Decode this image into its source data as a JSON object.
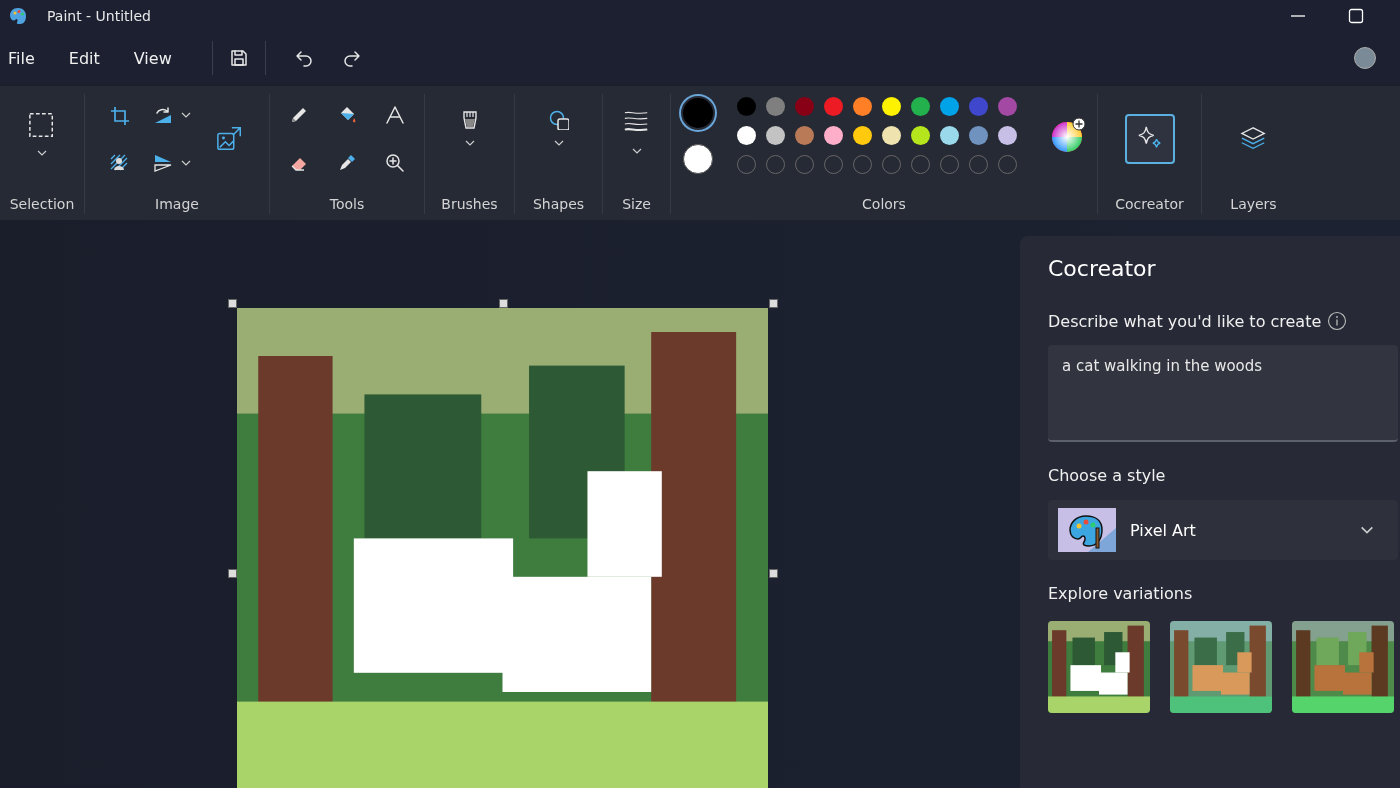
{
  "window": {
    "title": "Paint - Untitled"
  },
  "menu": [
    {
      "label": "File"
    },
    {
      "label": "Edit"
    },
    {
      "label": "View"
    }
  ],
  "quick_actions": [
    {
      "kind": "save"
    },
    {
      "kind": "undo"
    },
    {
      "kind": "redo"
    }
  ],
  "ribbon": [
    {
      "label": "Selection",
      "tools": [
        {
          "kind": "select",
          "dropdown": true
        }
      ]
    },
    {
      "label": "Image",
      "tools": [
        {
          "kind": "crop",
          "dropdown": false
        },
        {
          "kind": "rotate",
          "dropdown": true
        },
        {
          "kind": "resize",
          "dropdown": false
        },
        {
          "kind": "hatch",
          "dropdown": false
        },
        {
          "kind": "flip",
          "dropdown": true
        }
      ]
    },
    {
      "label": "Tools",
      "tools": [
        {
          "kind": "pencil",
          "dropdown": false
        },
        {
          "kind": "fill",
          "dropdown": false
        },
        {
          "kind": "text",
          "dropdown": false
        },
        {
          "kind": "eraser",
          "dropdown": false
        },
        {
          "kind": "picker",
          "dropdown": false
        },
        {
          "kind": "zoom",
          "dropdown": false
        }
      ]
    },
    {
      "label": "Brushes",
      "tools": [
        {
          "kind": "brush",
          "dropdown": true
        }
      ]
    },
    {
      "label": "Shapes",
      "tools": [
        {
          "kind": "shapes",
          "dropdown": true
        }
      ]
    },
    {
      "label": "Size",
      "tools": [
        {
          "kind": "size",
          "dropdown": true
        }
      ]
    }
  ],
  "colors": {
    "label": "Colors",
    "current": [
      {
        "color": "#000000",
        "selected": true
      },
      {
        "color": "#ffffff",
        "selected": false
      }
    ],
    "palette": [
      {
        "kind": "swatch",
        "color": "#000000"
      },
      {
        "kind": "swatch",
        "color": "#7f7f7f"
      },
      {
        "kind": "swatch",
        "color": "#880015"
      },
      {
        "kind": "swatch",
        "color": "#ed1c24"
      },
      {
        "kind": "swatch",
        "color": "#ff7f27"
      },
      {
        "kind": "swatch",
        "color": "#fff200"
      },
      {
        "kind": "swatch",
        "color": "#22b14c"
      },
      {
        "kind": "swatch",
        "color": "#00a2e8"
      },
      {
        "kind": "swatch",
        "color": "#3f48cc"
      },
      {
        "kind": "swatch",
        "color": "#a349a4"
      },
      {
        "kind": "swatch",
        "color": "#ffffff"
      },
      {
        "kind": "swatch",
        "color": "#c3c3c3"
      },
      {
        "kind": "swatch",
        "color": "#b97a57"
      },
      {
        "kind": "swatch",
        "color": "#ffaec9"
      },
      {
        "kind": "swatch",
        "color": "#ffc90e"
      },
      {
        "kind": "swatch",
        "color": "#efe4b0"
      },
      {
        "kind": "swatch",
        "color": "#b5e61d"
      },
      {
        "kind": "swatch",
        "color": "#99d9ea"
      },
      {
        "kind": "swatch",
        "color": "#7092be"
      },
      {
        "kind": "swatch",
        "color": "#c8bfe7"
      },
      {
        "kind": "empty"
      },
      {
        "kind": "empty"
      },
      {
        "kind": "empty"
      },
      {
        "kind": "empty"
      },
      {
        "kind": "empty"
      },
      {
        "kind": "empty"
      },
      {
        "kind": "empty"
      },
      {
        "kind": "empty"
      },
      {
        "kind": "empty"
      },
      {
        "kind": "empty"
      }
    ]
  },
  "features": [
    {
      "label": "Cocreator",
      "kind": "sparkle",
      "selected": true
    },
    {
      "label": "Layers",
      "kind": "layers",
      "selected": false
    }
  ],
  "cocreator_panel": {
    "title": "Cocreator",
    "prompt_label": "Describe what you'd like to create",
    "prompt_value": "a cat walking in the woods",
    "style_label": "Choose a style",
    "style_value": "Pixel Art",
    "variations_label": "Explore variations"
  }
}
